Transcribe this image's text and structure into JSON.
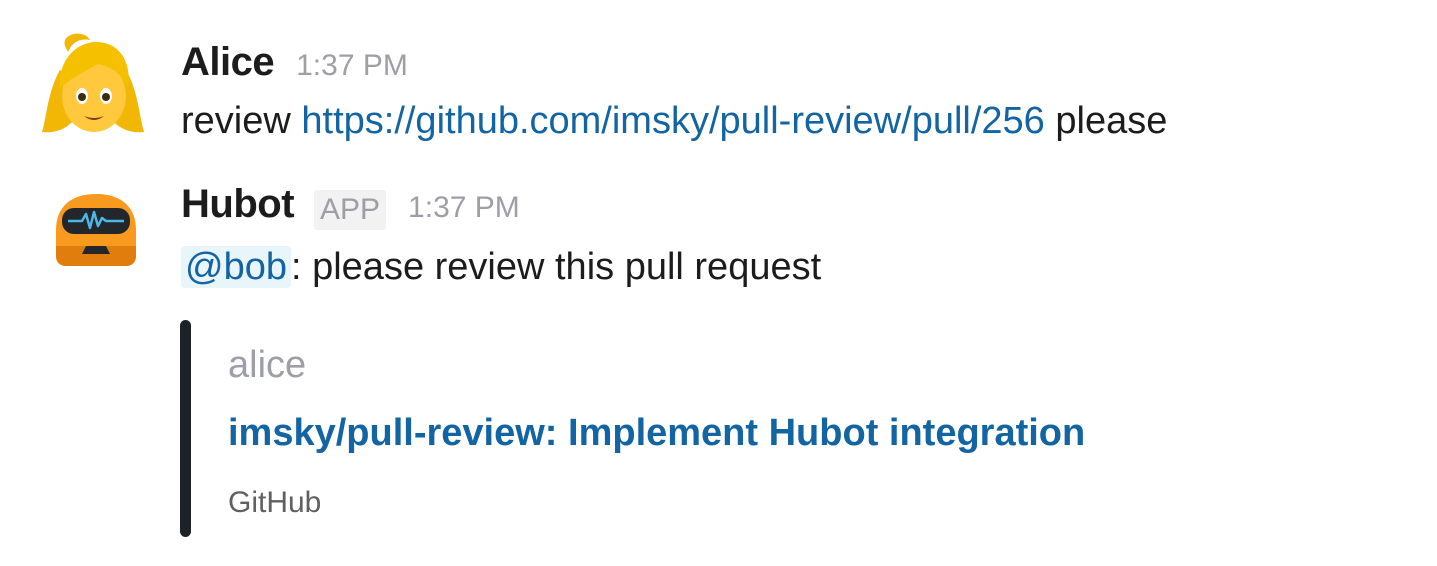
{
  "messages": [
    {
      "sender": "Alice",
      "time": "1:37 PM",
      "avatar_icon": "woman-blonde-emoji-icon",
      "text_before": "review ",
      "link": "https://github.com/imsky/pull-review/pull/256",
      "text_after": " please"
    },
    {
      "sender": "Hubot",
      "badge": "APP",
      "time": "1:37 PM",
      "avatar_icon": "hubot-robot-icon",
      "mention": "@bob",
      "text_after": ": please review this pull request",
      "attachment": {
        "author": "alice",
        "title": "imsky/pull-review: Implement Hubot integration",
        "footer": "GitHub",
        "bar_color": "#1d2228"
      }
    }
  ],
  "colors": {
    "link": "#1264a3",
    "mention_bg": "#e8f5fa",
    "muted": "#9e9ea6",
    "text": "#1d1c1d"
  }
}
